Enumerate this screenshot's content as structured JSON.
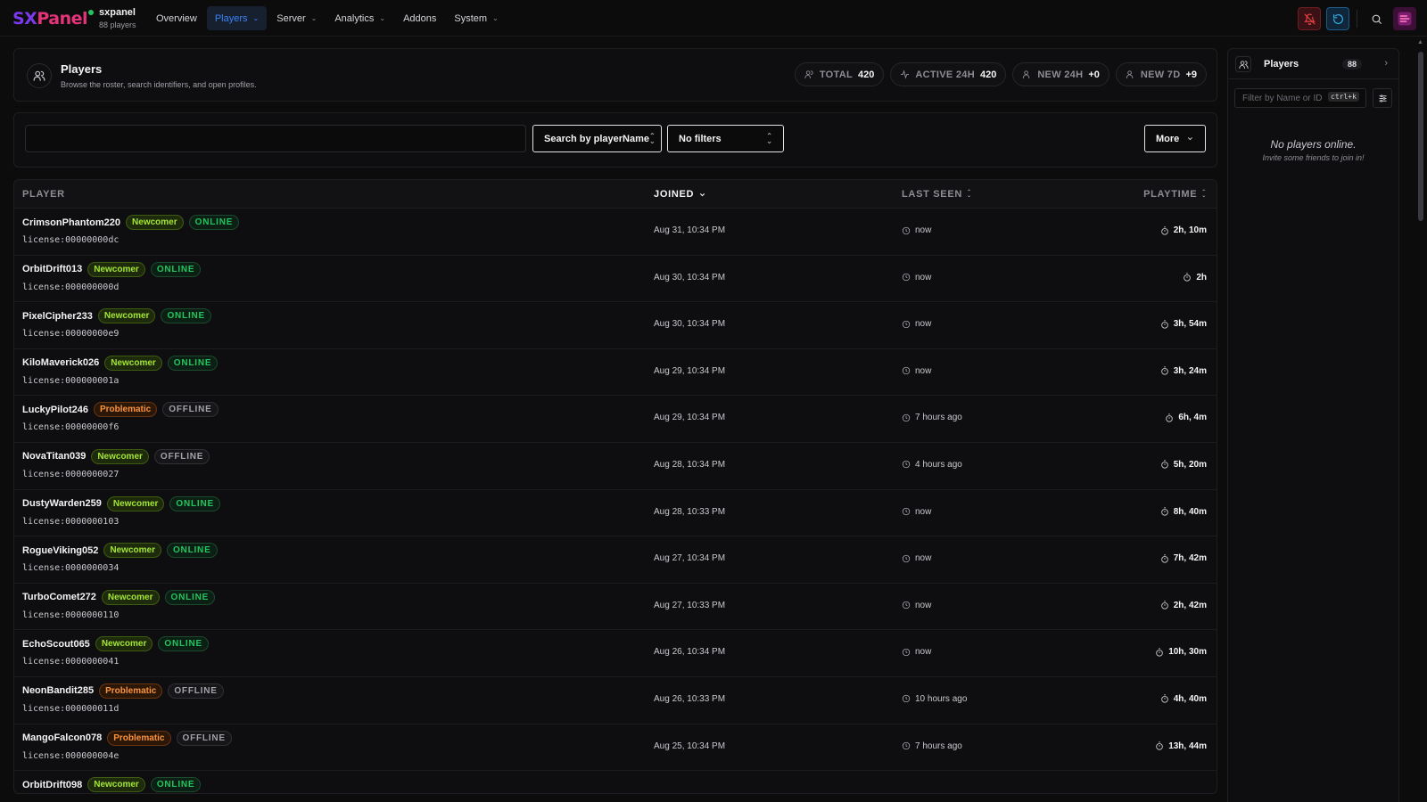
{
  "app": {
    "logo_sx": "SX",
    "logo_rest": "Panel",
    "server_name": "sxpanel",
    "server_players": "88 players"
  },
  "nav": [
    {
      "label": "Overview",
      "dropdown": false,
      "active": false
    },
    {
      "label": "Players",
      "dropdown": true,
      "active": true
    },
    {
      "label": "Server",
      "dropdown": true,
      "active": false
    },
    {
      "label": "Analytics",
      "dropdown": true,
      "active": false
    },
    {
      "label": "Addons",
      "dropdown": false,
      "active": false
    },
    {
      "label": "System",
      "dropdown": true,
      "active": false
    }
  ],
  "header": {
    "title": "Players",
    "subtitle": "Browse the roster, search identifiers, and open profiles.",
    "stats": [
      {
        "icon": "users-icon",
        "label": "TOTAL",
        "value": "420"
      },
      {
        "icon": "activity-icon",
        "label": "ACTIVE 24H",
        "value": "420"
      },
      {
        "icon": "user-plus-icon",
        "label": "NEW 24H",
        "value": "+0"
      },
      {
        "icon": "user-plus-icon",
        "label": "NEW 7D",
        "value": "+9"
      }
    ]
  },
  "search": {
    "value": "",
    "placeholder": "",
    "mode_label": "Search by playerName",
    "filter_label": "No filters",
    "more_label": "More"
  },
  "table": {
    "headers": {
      "player": "PLAYER",
      "joined": "JOINED",
      "last_seen": "LAST SEEN",
      "playtime": "PLAYTIME"
    },
    "rows": [
      {
        "name": "CrimsonPhantom220",
        "tag": "Newcomer",
        "status": "ONLINE",
        "license": "license:00000000dc",
        "joined": "Aug 31, 10:34 PM",
        "last_seen": "now",
        "playtime": "2h, 10m"
      },
      {
        "name": "OrbitDrift013",
        "tag": "Newcomer",
        "status": "ONLINE",
        "license": "license:000000000d",
        "joined": "Aug 30, 10:34 PM",
        "last_seen": "now",
        "playtime": "2h"
      },
      {
        "name": "PixelCipher233",
        "tag": "Newcomer",
        "status": "ONLINE",
        "license": "license:00000000e9",
        "joined": "Aug 30, 10:34 PM",
        "last_seen": "now",
        "playtime": "3h, 54m"
      },
      {
        "name": "KiloMaverick026",
        "tag": "Newcomer",
        "status": "ONLINE",
        "license": "license:000000001a",
        "joined": "Aug 29, 10:34 PM",
        "last_seen": "now",
        "playtime": "3h, 24m"
      },
      {
        "name": "LuckyPilot246",
        "tag": "Problematic",
        "status": "OFFLINE",
        "license": "license:00000000f6",
        "joined": "Aug 29, 10:34 PM",
        "last_seen": "7 hours ago",
        "playtime": "6h, 4m"
      },
      {
        "name": "NovaTitan039",
        "tag": "Newcomer",
        "status": "OFFLINE",
        "license": "license:0000000027",
        "joined": "Aug 28, 10:34 PM",
        "last_seen": "4 hours ago",
        "playtime": "5h, 20m"
      },
      {
        "name": "DustyWarden259",
        "tag": "Newcomer",
        "status": "ONLINE",
        "license": "license:0000000103",
        "joined": "Aug 28, 10:33 PM",
        "last_seen": "now",
        "playtime": "8h, 40m"
      },
      {
        "name": "RogueViking052",
        "tag": "Newcomer",
        "status": "ONLINE",
        "license": "license:0000000034",
        "joined": "Aug 27, 10:34 PM",
        "last_seen": "now",
        "playtime": "7h, 42m"
      },
      {
        "name": "TurboComet272",
        "tag": "Newcomer",
        "status": "ONLINE",
        "license": "license:0000000110",
        "joined": "Aug 27, 10:33 PM",
        "last_seen": "now",
        "playtime": "2h, 42m"
      },
      {
        "name": "EchoScout065",
        "tag": "Newcomer",
        "status": "ONLINE",
        "license": "license:0000000041",
        "joined": "Aug 26, 10:34 PM",
        "last_seen": "now",
        "playtime": "10h, 30m"
      },
      {
        "name": "NeonBandit285",
        "tag": "Problematic",
        "status": "OFFLINE",
        "license": "license:000000011d",
        "joined": "Aug 26, 10:33 PM",
        "last_seen": "10 hours ago",
        "playtime": "4h, 40m"
      },
      {
        "name": "MangoFalcon078",
        "tag": "Problematic",
        "status": "OFFLINE",
        "license": "license:000000004e",
        "joined": "Aug 25, 10:34 PM",
        "last_seen": "7 hours ago",
        "playtime": "13h, 44m"
      },
      {
        "name": "OrbitDrift098",
        "tag": "Newcomer",
        "status": "ONLINE",
        "license": "",
        "joined": "",
        "last_seen": "",
        "playtime": ""
      }
    ]
  },
  "side": {
    "title": "Players",
    "count": "88",
    "filter_placeholder": "Filter by Name or ID",
    "shortcut": "ctrl+k",
    "empty_title": "No players online.",
    "empty_sub": "Invite some friends to join in!"
  },
  "colors": {
    "accent": "#3b82f6",
    "brand_sx": "#7c3aed",
    "brand_panel": "#e5337a",
    "online": "#22c55e",
    "newcomer": "#a3e635",
    "problematic": "#fb923c"
  }
}
